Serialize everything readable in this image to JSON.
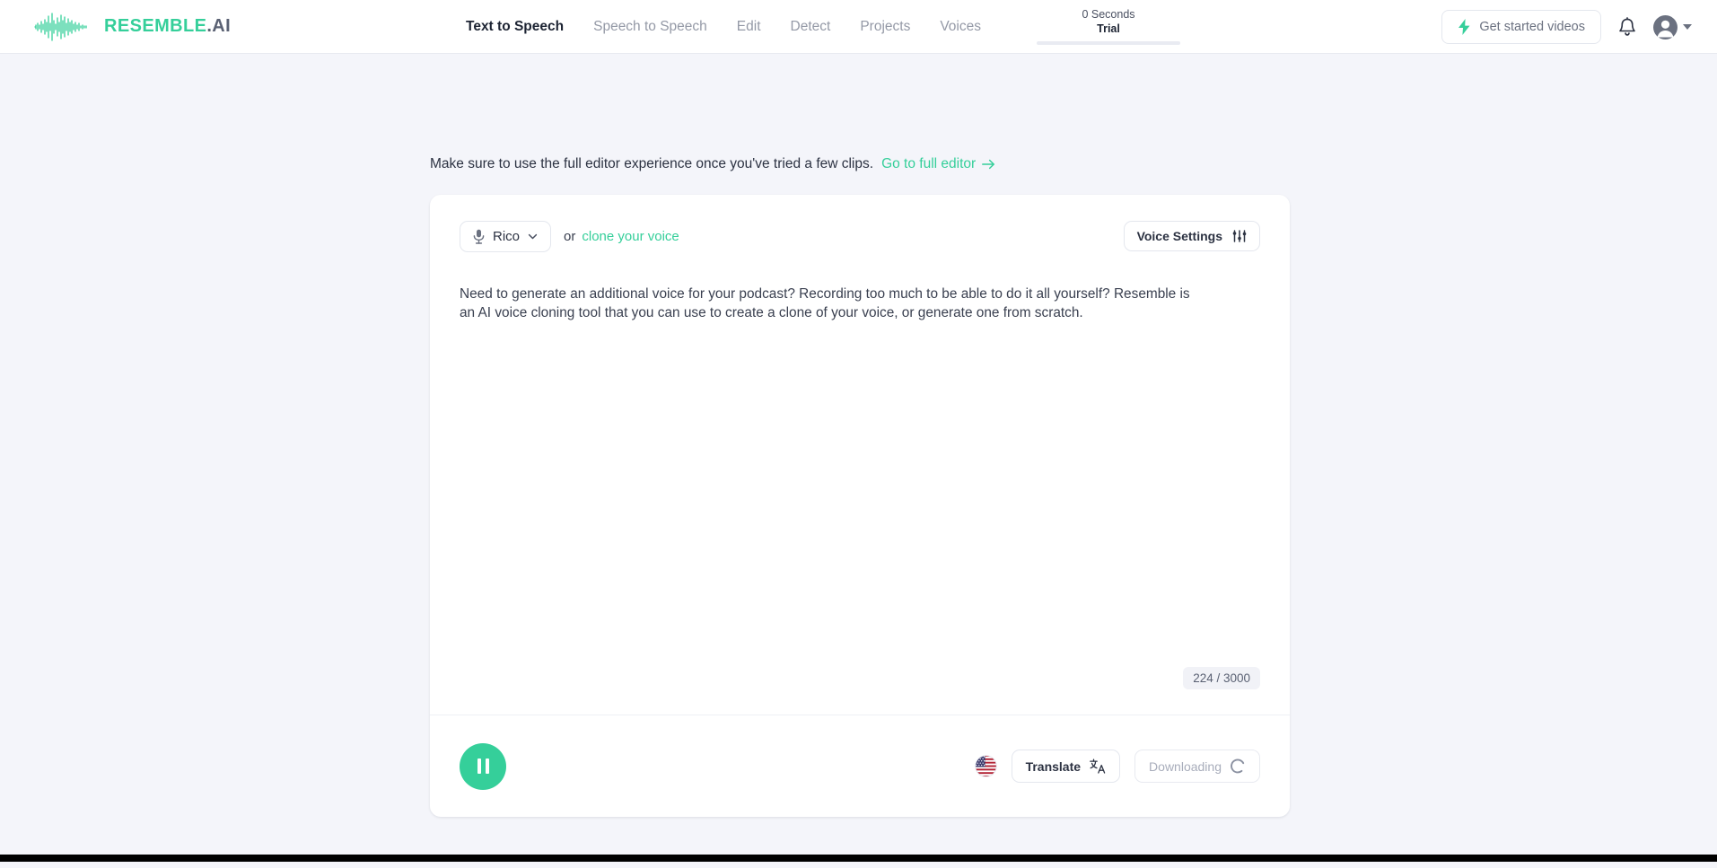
{
  "brand": {
    "name_part1": "RESEMBLE",
    "name_part2": ".AI",
    "logo_icon": "waveform-icon"
  },
  "nav": {
    "items": [
      {
        "label": "Text to Speech",
        "active": true
      },
      {
        "label": "Speech to Speech",
        "active": false
      },
      {
        "label": "Edit",
        "active": false
      },
      {
        "label": "Detect",
        "active": false
      },
      {
        "label": "Projects",
        "active": false
      },
      {
        "label": "Voices",
        "active": false
      }
    ]
  },
  "trial": {
    "seconds": "0 Seconds",
    "plan": "Trial",
    "progress_percent": 0
  },
  "topbar_right": {
    "get_started_label": "Get started videos",
    "get_started_icon": "lightning-bolt-icon",
    "notification_icon": "bell-icon",
    "avatar_icon": "user-avatar-icon",
    "avatar_caret_icon": "chevron-down-icon"
  },
  "notice": {
    "text": "Make sure to use the full editor experience once you've tried a few clips.",
    "link_label": "Go to full editor",
    "link_icon": "arrow-right-icon"
  },
  "editor": {
    "voice": {
      "icon": "microphone-icon",
      "name": "Rico",
      "caret_icon": "chevron-down-icon"
    },
    "or_label": "or",
    "clone_link_label": "clone your voice",
    "voice_settings_label": "Voice Settings",
    "voice_settings_icon": "sliders-icon",
    "body_text": "Need to generate an additional voice for your podcast? Recording too much to be able to do it all yourself? Resemble is an AI voice cloning tool that you can use to create a clone of your voice, or generate one from scratch.",
    "char_count": "224 / 3000"
  },
  "controls": {
    "play_state_icon": "pause-icon",
    "language_flag": "us-flag-icon",
    "translate_label": "Translate",
    "translate_icon": "translate-icon",
    "download_label": "Downloading",
    "download_icon": "spinner-icon"
  },
  "colors": {
    "accent": "#35cf9a",
    "page_background": "#f4f5fa",
    "card_background": "#ffffff",
    "text_primary": "#1d2433",
    "text_muted": "#9499a6"
  }
}
